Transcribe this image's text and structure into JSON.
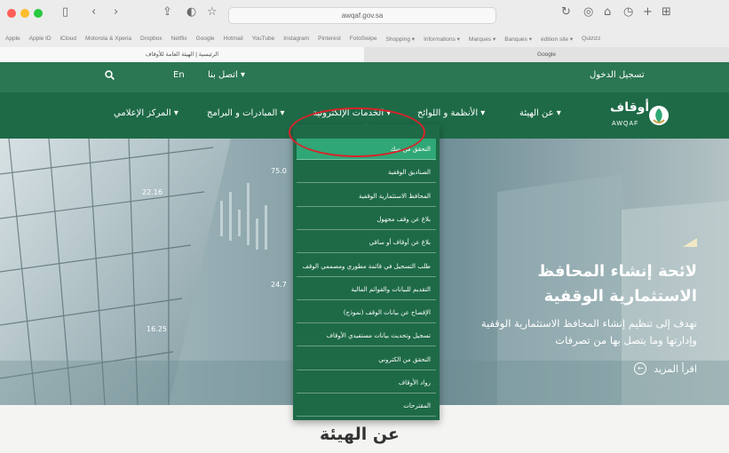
{
  "browser": {
    "url": "awqaf.gov.sa",
    "bookmarks": [
      "Apple",
      "Apple ID",
      "iCloud",
      "Motorola & Xperia",
      "Dropbox",
      "Netflix",
      "Google",
      "Hotmail",
      "YouTube",
      "Instagram",
      "Pinterest",
      "FotoSwipe",
      "Shopping ▾",
      "Informations ▾",
      "Marques ▾",
      "Banques ▾",
      "édition site ▾",
      "Quizizz"
    ],
    "tab_active": "الرئيسية | الهيئة العامة للأوقاف",
    "tab_other": "Google"
  },
  "topbar": {
    "login": "تسجيل الدخول",
    "contact": "اتصل بنا ▾",
    "language": "En"
  },
  "nav": {
    "about": "عن الهيئة ▾",
    "regulations": "الأنظمة و اللوائح ▾",
    "eservices": "الخدمات الإلكترونية ▾",
    "initiatives": "المبادرات و البرامج ▾",
    "media": "المركز الإعلامي ▾"
  },
  "logo": {
    "arabic": "أوقاف",
    "latin": "AWQAF"
  },
  "dropdown": {
    "items": [
      "التحقق من صك",
      "الصناديق الوقفية",
      "المحافظ الاستثمارية الوقفية",
      "بلاغ عن وقف مجهول",
      "بلاغ عن أوقاف أو ساقي",
      "طلب التسجيل في قائمة مطوري ومصممي الوقف",
      "التقديم للبيانات والقوائم المالية",
      "الإفصاح عن بيانات الوقف (نموذج)",
      "تسجيل وتحديث بيانات مستفيدي الأوقاف",
      "التحقق من الكتروني",
      "رواد الأوقاف",
      "المقترحات"
    ]
  },
  "hero": {
    "title_line1": "لائحة إنشاء المحافظ",
    "title_line2": "الاستثمارية الوقفية",
    "description": "تهدف إلى تنظيم إنشاء المحافظ الاستثمارية الوقفية وإدارتها وما يتصل بها من تصرفات",
    "more": "اقرأ المزيد",
    "chart_labels": [
      "22.16",
      "75.0",
      "24.7",
      "16.25"
    ]
  },
  "section": {
    "title": "عن الهيئة"
  },
  "colors": {
    "primary_green": "#1e6a47",
    "topbar_green": "#2b7653",
    "active_item": "#2fa776",
    "annotation_red": "#d9232a"
  }
}
